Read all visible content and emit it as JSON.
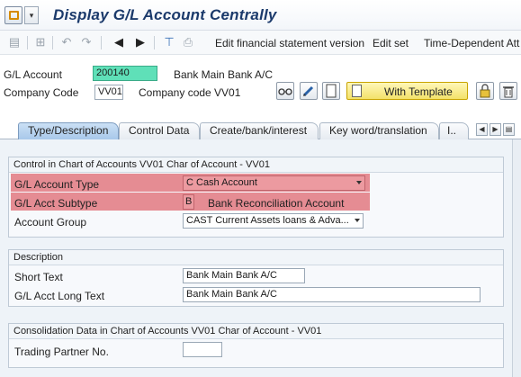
{
  "window": {
    "title": "Display G/L Account Centrally"
  },
  "toolbar": {
    "edit_fs_version": "Edit financial statement version",
    "edit_set": "Edit set",
    "time_dependent": "Time-Dependent Att"
  },
  "header": {
    "gl_account_label": "G/L Account",
    "gl_account_value": "200140",
    "gl_account_desc": "Bank Main Bank A/C",
    "company_code_label": "Company Code",
    "company_code_value": "VV01",
    "company_code_desc": "Company code VV01",
    "template_button": "With Template"
  },
  "tabs": [
    {
      "label": "Type/Description",
      "active": true
    },
    {
      "label": "Control Data",
      "active": false
    },
    {
      "label": "Create/bank/interest",
      "active": false
    },
    {
      "label": "Key word/translation",
      "active": false
    },
    {
      "label": "I..",
      "active": false
    }
  ],
  "control_group": {
    "title": "Control in Chart of Accounts VV01 Char of Account - VV01",
    "account_type_label": "G/L Account Type",
    "account_type_value": "C Cash Account",
    "acct_subtype_label": "G/L Acct Subtype",
    "acct_subtype_value": "B",
    "acct_subtype_desc": "Bank Reconciliation Account",
    "account_group_label": "Account Group",
    "account_group_value": "CAST Current Assets loans & Adva..."
  },
  "description_group": {
    "title": "Description",
    "short_text_label": "Short Text",
    "short_text_value": "Bank Main Bank A/C",
    "long_text_label": "G/L Acct Long Text",
    "long_text_value": "Bank Main Bank A/C"
  },
  "consolidation_group": {
    "title": "Consolidation Data in Chart of Accounts VV01 Char of Account - VV01",
    "trading_partner_label": "Trading Partner No.",
    "trading_partner_value": ""
  },
  "colors": {
    "highlight": "#e58c93",
    "gl_account_field": "#5fe0b8",
    "active_tab": "#a8c8ea",
    "title_text": "#1b3a6b"
  }
}
